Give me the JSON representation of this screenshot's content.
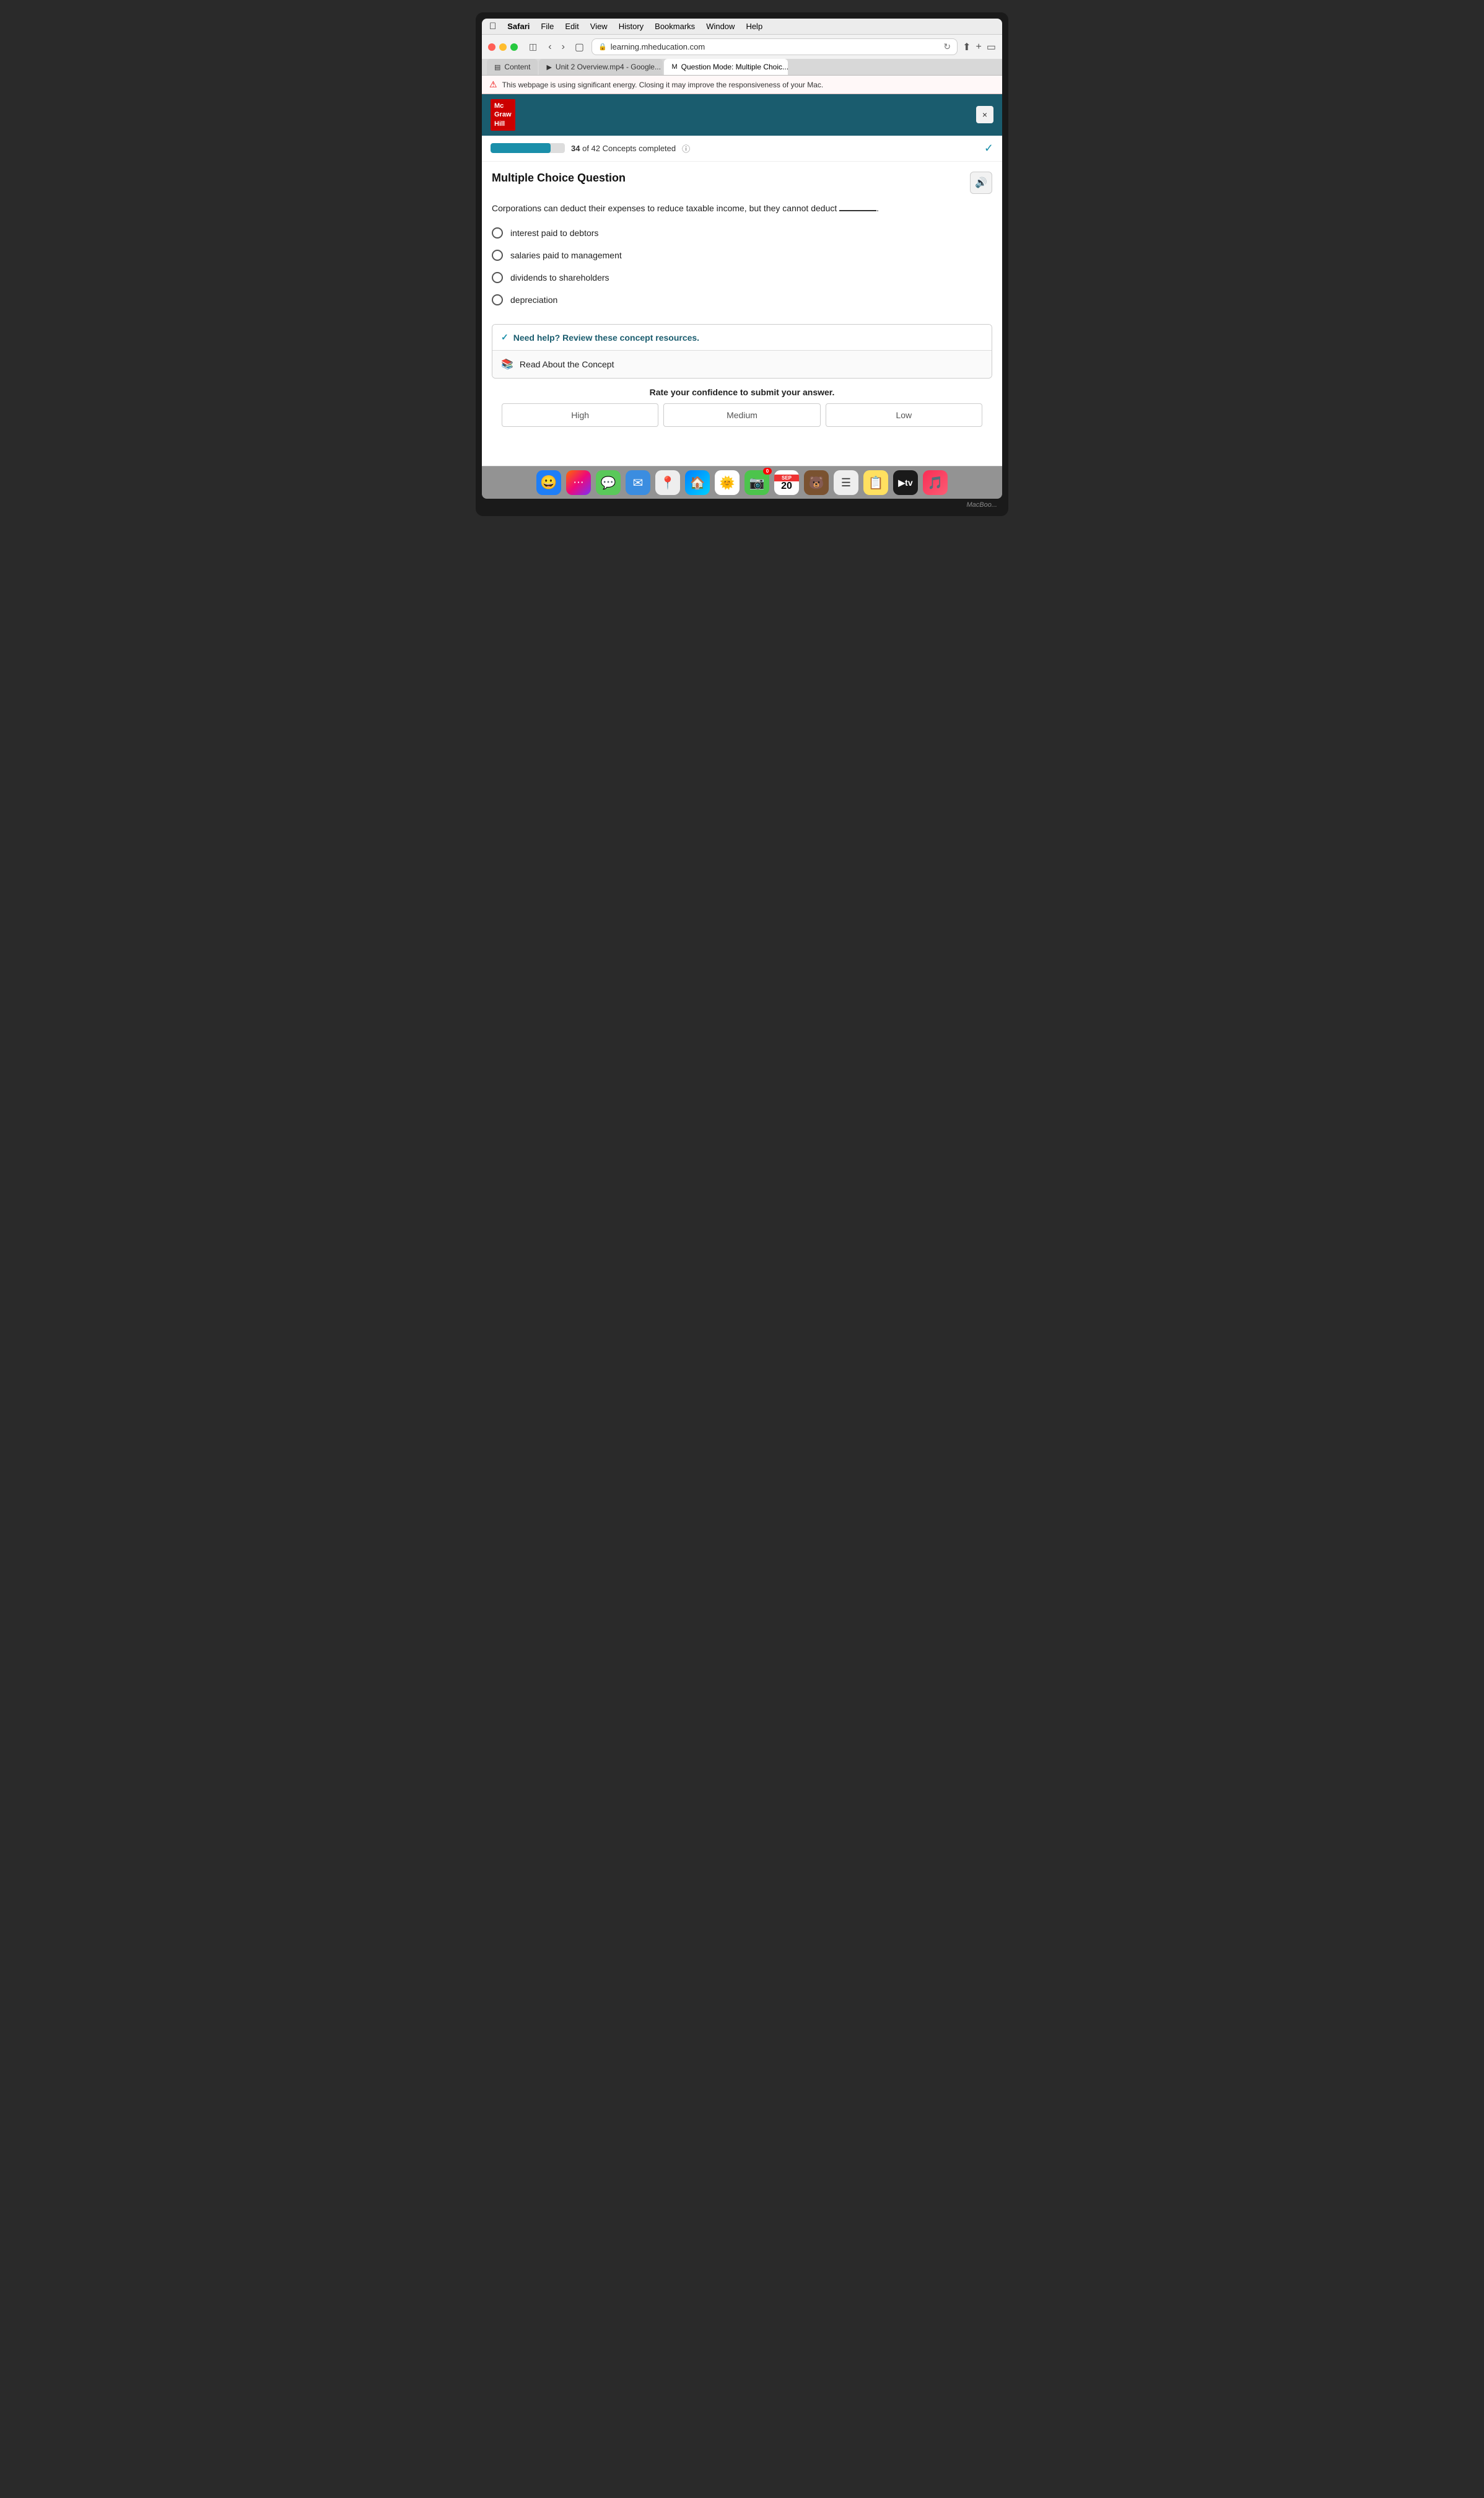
{
  "menubar": {
    "apple": "&#63743;",
    "items": [
      "Safari",
      "File",
      "Edit",
      "View",
      "History",
      "Bookmarks",
      "Window",
      "Help"
    ]
  },
  "browser": {
    "url": "learning.mheducation.com",
    "tabs": [
      {
        "id": "content",
        "label": "Content",
        "icon": "&#9636;",
        "active": false
      },
      {
        "id": "unit2",
        "label": "Unit 2 Overview.mp4 - Google...",
        "icon": "&#9654;",
        "active": false
      },
      {
        "id": "question",
        "label": "Question Mode: Multiple Choic...",
        "icon": "M",
        "active": true
      }
    ],
    "warning": "This webpage is using significant energy. Closing it may improve the responsiveness of your Mac."
  },
  "mgh": {
    "logo_line1": "Mc",
    "logo_line2": "Graw",
    "logo_line3": "Hill",
    "close_label": "×"
  },
  "progress": {
    "current": 34,
    "total": 42,
    "label": "of 42 Concepts completed",
    "percent": 81
  },
  "question": {
    "title": "Multiple Choice Question",
    "text": "Corporations can deduct their expenses to reduce taxable income, but they cannot deduct",
    "options": [
      "interest paid to debtors",
      "salaries paid to management",
      "dividends to shareholders",
      "depreciation"
    ]
  },
  "help": {
    "header": "Need help? Review these concept resources.",
    "read_label": "Read About the Concept"
  },
  "confidence": {
    "title": "Rate your confidence to submit your answer.",
    "buttons": [
      "High",
      "Medium",
      "Low"
    ]
  },
  "dock": {
    "items": [
      {
        "name": "finder",
        "icon": "&#128512;",
        "color": "#1e7ef7"
      },
      {
        "name": "launchpad",
        "icon": "&#10752;",
        "color": "#f0f0f0"
      },
      {
        "name": "messages",
        "icon": "&#128172;",
        "color": "#5ac85a"
      },
      {
        "name": "mail",
        "icon": "&#9993;",
        "color": "#3b8de0"
      },
      {
        "name": "maps",
        "icon": "&#128205;",
        "color": "#5ac85a"
      },
      {
        "name": "safari",
        "icon": "&#127968;",
        "color": "#3b8de0"
      },
      {
        "name": "photos",
        "icon": "&#127774;",
        "color": "#e0a030"
      },
      {
        "name": "facetime",
        "icon": "&#128247;",
        "color": "#5ac85a",
        "badge": "0"
      },
      {
        "name": "notes",
        "icon": "&#128203;",
        "color": "#ffe060"
      },
      {
        "name": "appletv",
        "icon": "&#9654;",
        "color": "#1a1a1a"
      },
      {
        "name": "music",
        "icon": "&#127925;",
        "color": "#fa2d55"
      }
    ],
    "date_month": "SEP",
    "date_day": "20"
  },
  "macbook_label": "MacBoo..."
}
